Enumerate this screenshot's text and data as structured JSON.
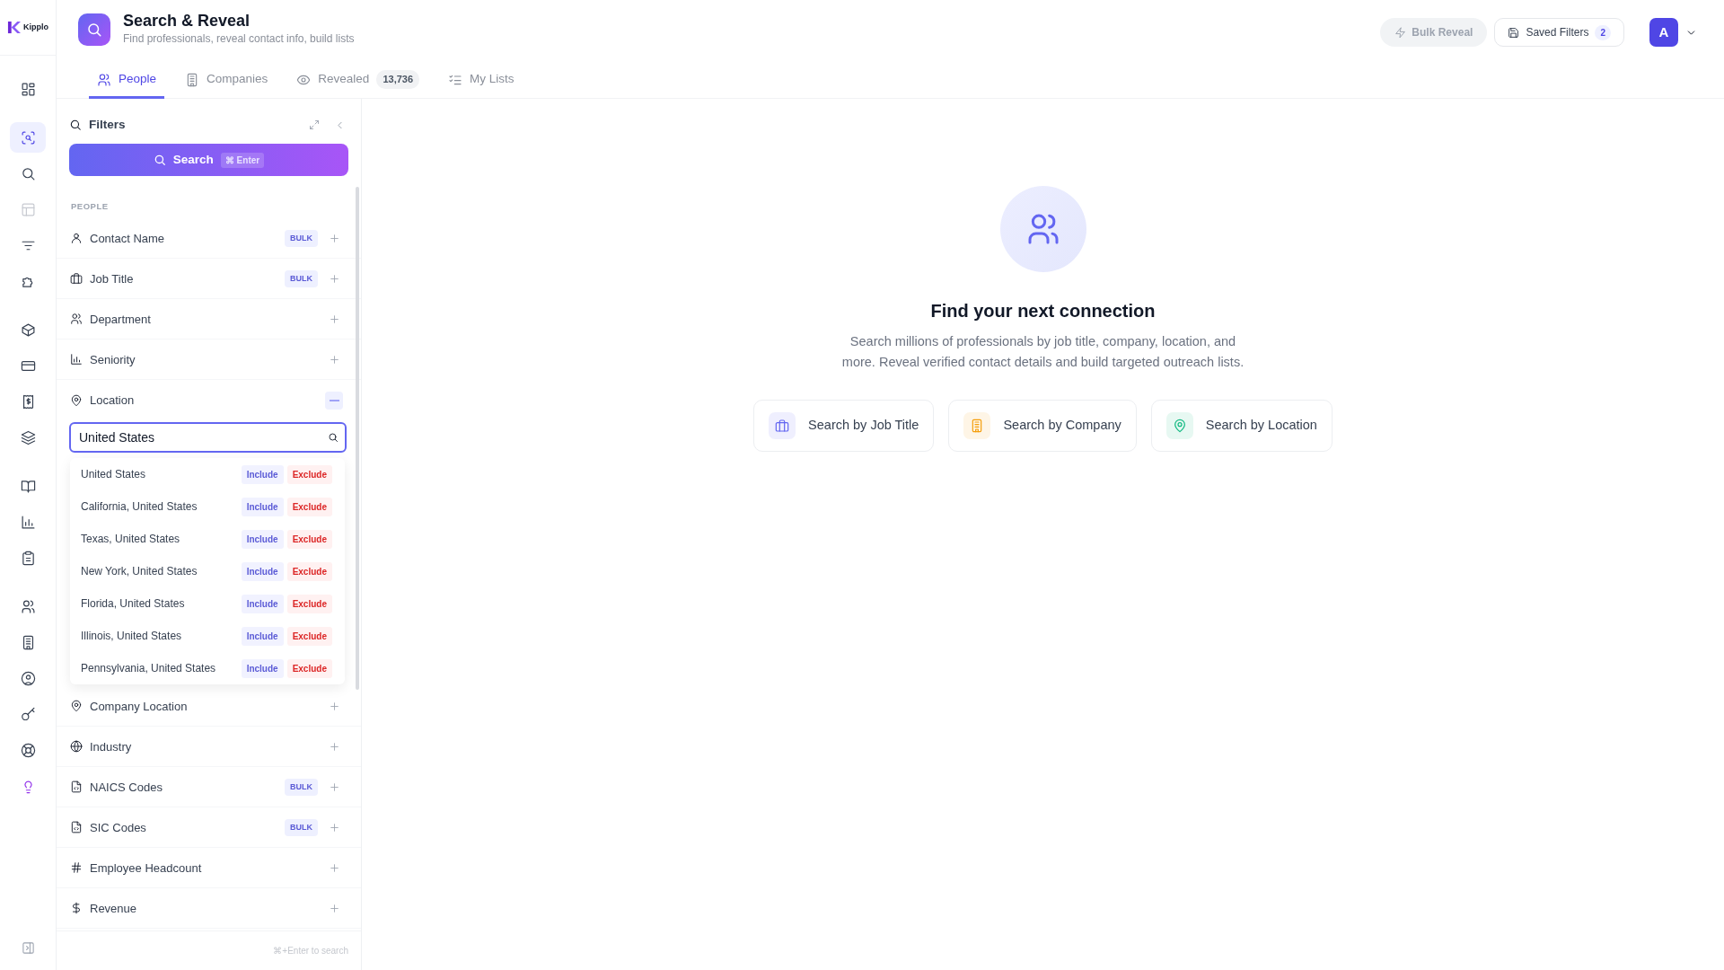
{
  "app": {
    "logo_text": "Kipplo"
  },
  "rail": {
    "groups": [
      [
        {
          "selected": false,
          "disabled": false,
          "accent": false
        }
      ],
      [
        {
          "selected": true,
          "disabled": false,
          "accent": false
        },
        {
          "selected": false,
          "disabled": false,
          "accent": false
        },
        {
          "selected": false,
          "disabled": true,
          "accent": false
        },
        {
          "selected": false,
          "disabled": false,
          "accent": false
        },
        {
          "selected": false,
          "disabled": false,
          "accent": false
        }
      ],
      [
        {
          "selected": false,
          "disabled": false,
          "accent": false
        },
        {
          "selected": false,
          "disabled": false,
          "accent": false
        },
        {
          "selected": false,
          "disabled": false,
          "accent": false
        },
        {
          "selected": false,
          "disabled": false,
          "accent": false
        }
      ],
      [
        {
          "selected": false,
          "disabled": false,
          "accent": false
        },
        {
          "selected": false,
          "disabled": false,
          "accent": false
        },
        {
          "selected": false,
          "disabled": false,
          "accent": false
        }
      ],
      [
        {
          "selected": false,
          "disabled": false,
          "accent": false
        },
        {
          "selected": false,
          "disabled": false,
          "accent": false
        },
        {
          "selected": false,
          "disabled": false,
          "accent": false
        },
        {
          "selected": false,
          "disabled": false,
          "accent": false
        },
        {
          "selected": false,
          "disabled": false,
          "accent": false
        },
        {
          "selected": false,
          "disabled": false,
          "accent": true
        }
      ]
    ]
  },
  "header": {
    "title": "Search & Reveal",
    "subtitle": "Find professionals, reveal contact info, build lists",
    "tabs": [
      {
        "label": "People",
        "selected": true
      },
      {
        "label": "Companies",
        "selected": false
      },
      {
        "label": "Revealed",
        "count": "13,736",
        "selected": false
      },
      {
        "label": "My Lists",
        "selected": false
      }
    ],
    "bulk_reveal": {
      "label": "Bulk Reveal",
      "disabled": true
    },
    "saved_filters": {
      "label": "Saved Filters",
      "count": "2"
    },
    "avatar": {
      "initial": "A"
    }
  },
  "filters": {
    "title": "Filters",
    "search_button": {
      "label": "Search",
      "shortcut": "⌘ Enter"
    },
    "section": "PEOPLE",
    "items": [
      {
        "label": "Contact Name",
        "badge": "BULK",
        "expanded": false
      },
      {
        "label": "Job Title",
        "badge": "BULK",
        "expanded": false
      },
      {
        "label": "Department",
        "expanded": false
      },
      {
        "label": "Seniority",
        "expanded": false
      },
      {
        "label": "Location",
        "expanded": true,
        "search": {
          "value": "United States"
        },
        "options": [
          {
            "label": "United States",
            "include": "Include",
            "exclude": "Exclude"
          },
          {
            "label": "California, United States",
            "include": "Include",
            "exclude": "Exclude"
          },
          {
            "label": "Texas, United States",
            "include": "Include",
            "exclude": "Exclude"
          },
          {
            "label": "New York, United States",
            "include": "Include",
            "exclude": "Exclude"
          },
          {
            "label": "Florida, United States",
            "include": "Include",
            "exclude": "Exclude"
          },
          {
            "label": "Illinois, United States",
            "include": "Include",
            "exclude": "Exclude"
          },
          {
            "label": "Pennsylvania, United States",
            "include": "Include",
            "exclude": "Exclude"
          }
        ]
      },
      {
        "label": "Company Location",
        "expanded": false
      },
      {
        "label": "Industry",
        "expanded": false
      },
      {
        "label": "NAICS Codes",
        "badge": "BULK",
        "expanded": false
      },
      {
        "label": "SIC Codes",
        "badge": "BULK",
        "expanded": false
      },
      {
        "label": "Employee Headcount",
        "expanded": false
      },
      {
        "label": "Revenue",
        "expanded": false
      }
    ],
    "footer_hint": "⌘+Enter to search"
  },
  "empty_state": {
    "title": "Find your next connection",
    "text": "Search millions of professionals by job title, company, location, and more. Reveal verified contact details and build targeted outreach lists.",
    "actions": [
      {
        "label": "Search by Job Title",
        "color": "#6366f1"
      },
      {
        "label": "Search by Company",
        "color": "#f59e0b"
      },
      {
        "label": "Search by Location",
        "color": "#10b981"
      }
    ]
  }
}
